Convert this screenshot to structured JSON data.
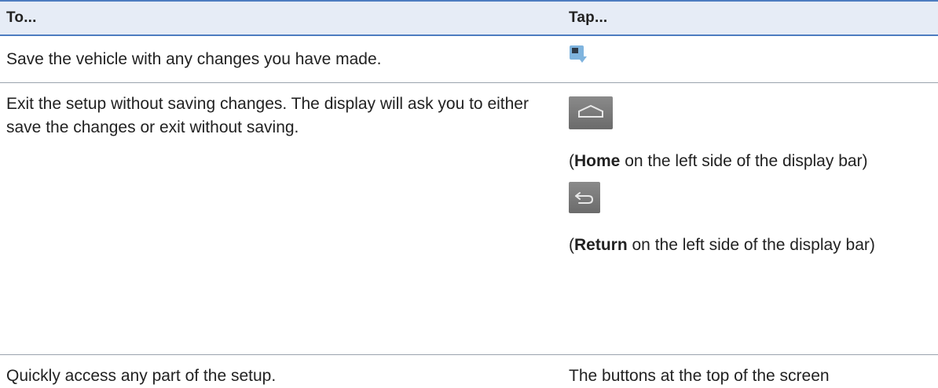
{
  "table": {
    "headers": {
      "to": "To...",
      "tap": "Tap..."
    },
    "rows": [
      {
        "to": "Save the vehicle with any changes you have made.",
        "tap_icon": "save-icon"
      },
      {
        "to": "Exit the setup without saving changes. The display will ask you to either save the changes or exit without saving.",
        "options": [
          {
            "icon": "home-icon",
            "name": "Home",
            "caption": " on the left side of the display bar)"
          },
          {
            "icon": "return-icon",
            "name": "Return",
            "caption": " on the left side of the display bar)"
          }
        ]
      },
      {
        "to": "Quickly access any part of the setup.",
        "tap_text": "The buttons at the top of the screen"
      }
    ]
  },
  "colors": {
    "header_background": "#e6ecf6",
    "header_rule": "#4d7cc0",
    "row_rule": "#9aa3ad",
    "save_icon": "#7fb4de",
    "button_gray": "#787878"
  }
}
